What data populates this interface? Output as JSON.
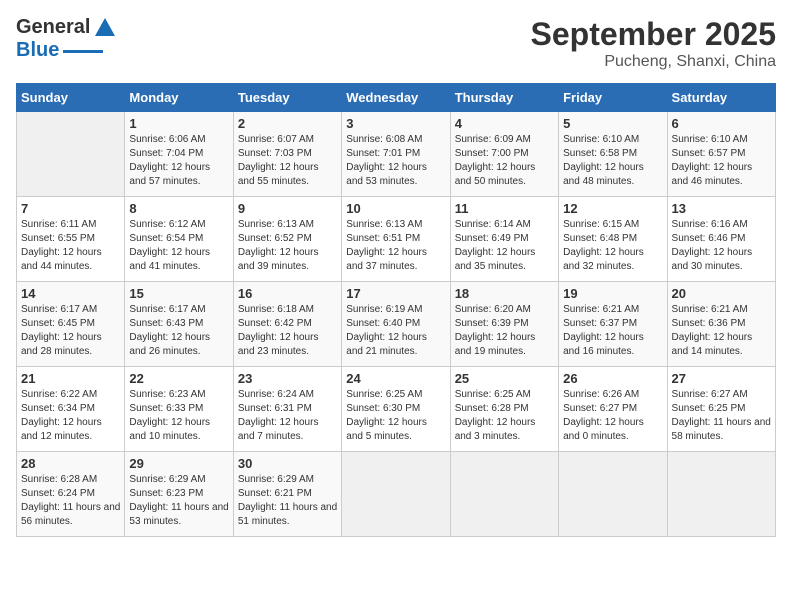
{
  "header": {
    "logo_general": "General",
    "logo_blue": "Blue",
    "month": "September 2025",
    "location": "Pucheng, Shanxi, China"
  },
  "days_of_week": [
    "Sunday",
    "Monday",
    "Tuesday",
    "Wednesday",
    "Thursday",
    "Friday",
    "Saturday"
  ],
  "weeks": [
    [
      {
        "day": "",
        "empty": true
      },
      {
        "day": "1",
        "sunrise": "6:06 AM",
        "sunset": "7:04 PM",
        "daylight": "12 hours and 57 minutes."
      },
      {
        "day": "2",
        "sunrise": "6:07 AM",
        "sunset": "7:03 PM",
        "daylight": "12 hours and 55 minutes."
      },
      {
        "day": "3",
        "sunrise": "6:08 AM",
        "sunset": "7:01 PM",
        "daylight": "12 hours and 53 minutes."
      },
      {
        "day": "4",
        "sunrise": "6:09 AM",
        "sunset": "7:00 PM",
        "daylight": "12 hours and 50 minutes."
      },
      {
        "day": "5",
        "sunrise": "6:10 AM",
        "sunset": "6:58 PM",
        "daylight": "12 hours and 48 minutes."
      },
      {
        "day": "6",
        "sunrise": "6:10 AM",
        "sunset": "6:57 PM",
        "daylight": "12 hours and 46 minutes."
      }
    ],
    [
      {
        "day": "7",
        "sunrise": "6:11 AM",
        "sunset": "6:55 PM",
        "daylight": "12 hours and 44 minutes."
      },
      {
        "day": "8",
        "sunrise": "6:12 AM",
        "sunset": "6:54 PM",
        "daylight": "12 hours and 41 minutes."
      },
      {
        "day": "9",
        "sunrise": "6:13 AM",
        "sunset": "6:52 PM",
        "daylight": "12 hours and 39 minutes."
      },
      {
        "day": "10",
        "sunrise": "6:13 AM",
        "sunset": "6:51 PM",
        "daylight": "12 hours and 37 minutes."
      },
      {
        "day": "11",
        "sunrise": "6:14 AM",
        "sunset": "6:49 PM",
        "daylight": "12 hours and 35 minutes."
      },
      {
        "day": "12",
        "sunrise": "6:15 AM",
        "sunset": "6:48 PM",
        "daylight": "12 hours and 32 minutes."
      },
      {
        "day": "13",
        "sunrise": "6:16 AM",
        "sunset": "6:46 PM",
        "daylight": "12 hours and 30 minutes."
      }
    ],
    [
      {
        "day": "14",
        "sunrise": "6:17 AM",
        "sunset": "6:45 PM",
        "daylight": "12 hours and 28 minutes."
      },
      {
        "day": "15",
        "sunrise": "6:17 AM",
        "sunset": "6:43 PM",
        "daylight": "12 hours and 26 minutes."
      },
      {
        "day": "16",
        "sunrise": "6:18 AM",
        "sunset": "6:42 PM",
        "daylight": "12 hours and 23 minutes."
      },
      {
        "day": "17",
        "sunrise": "6:19 AM",
        "sunset": "6:40 PM",
        "daylight": "12 hours and 21 minutes."
      },
      {
        "day": "18",
        "sunrise": "6:20 AM",
        "sunset": "6:39 PM",
        "daylight": "12 hours and 19 minutes."
      },
      {
        "day": "19",
        "sunrise": "6:21 AM",
        "sunset": "6:37 PM",
        "daylight": "12 hours and 16 minutes."
      },
      {
        "day": "20",
        "sunrise": "6:21 AM",
        "sunset": "6:36 PM",
        "daylight": "12 hours and 14 minutes."
      }
    ],
    [
      {
        "day": "21",
        "sunrise": "6:22 AM",
        "sunset": "6:34 PM",
        "daylight": "12 hours and 12 minutes."
      },
      {
        "day": "22",
        "sunrise": "6:23 AM",
        "sunset": "6:33 PM",
        "daylight": "12 hours and 10 minutes."
      },
      {
        "day": "23",
        "sunrise": "6:24 AM",
        "sunset": "6:31 PM",
        "daylight": "12 hours and 7 minutes."
      },
      {
        "day": "24",
        "sunrise": "6:25 AM",
        "sunset": "6:30 PM",
        "daylight": "12 hours and 5 minutes."
      },
      {
        "day": "25",
        "sunrise": "6:25 AM",
        "sunset": "6:28 PM",
        "daylight": "12 hours and 3 minutes."
      },
      {
        "day": "26",
        "sunrise": "6:26 AM",
        "sunset": "6:27 PM",
        "daylight": "12 hours and 0 minutes."
      },
      {
        "day": "27",
        "sunrise": "6:27 AM",
        "sunset": "6:25 PM",
        "daylight": "11 hours and 58 minutes."
      }
    ],
    [
      {
        "day": "28",
        "sunrise": "6:28 AM",
        "sunset": "6:24 PM",
        "daylight": "11 hours and 56 minutes."
      },
      {
        "day": "29",
        "sunrise": "6:29 AM",
        "sunset": "6:23 PM",
        "daylight": "11 hours and 53 minutes."
      },
      {
        "day": "30",
        "sunrise": "6:29 AM",
        "sunset": "6:21 PM",
        "daylight": "11 hours and 51 minutes."
      },
      {
        "day": "",
        "empty": true
      },
      {
        "day": "",
        "empty": true
      },
      {
        "day": "",
        "empty": true
      },
      {
        "day": "",
        "empty": true
      }
    ]
  ],
  "labels": {
    "sunrise": "Sunrise:",
    "sunset": "Sunset:",
    "daylight": "Daylight:"
  }
}
